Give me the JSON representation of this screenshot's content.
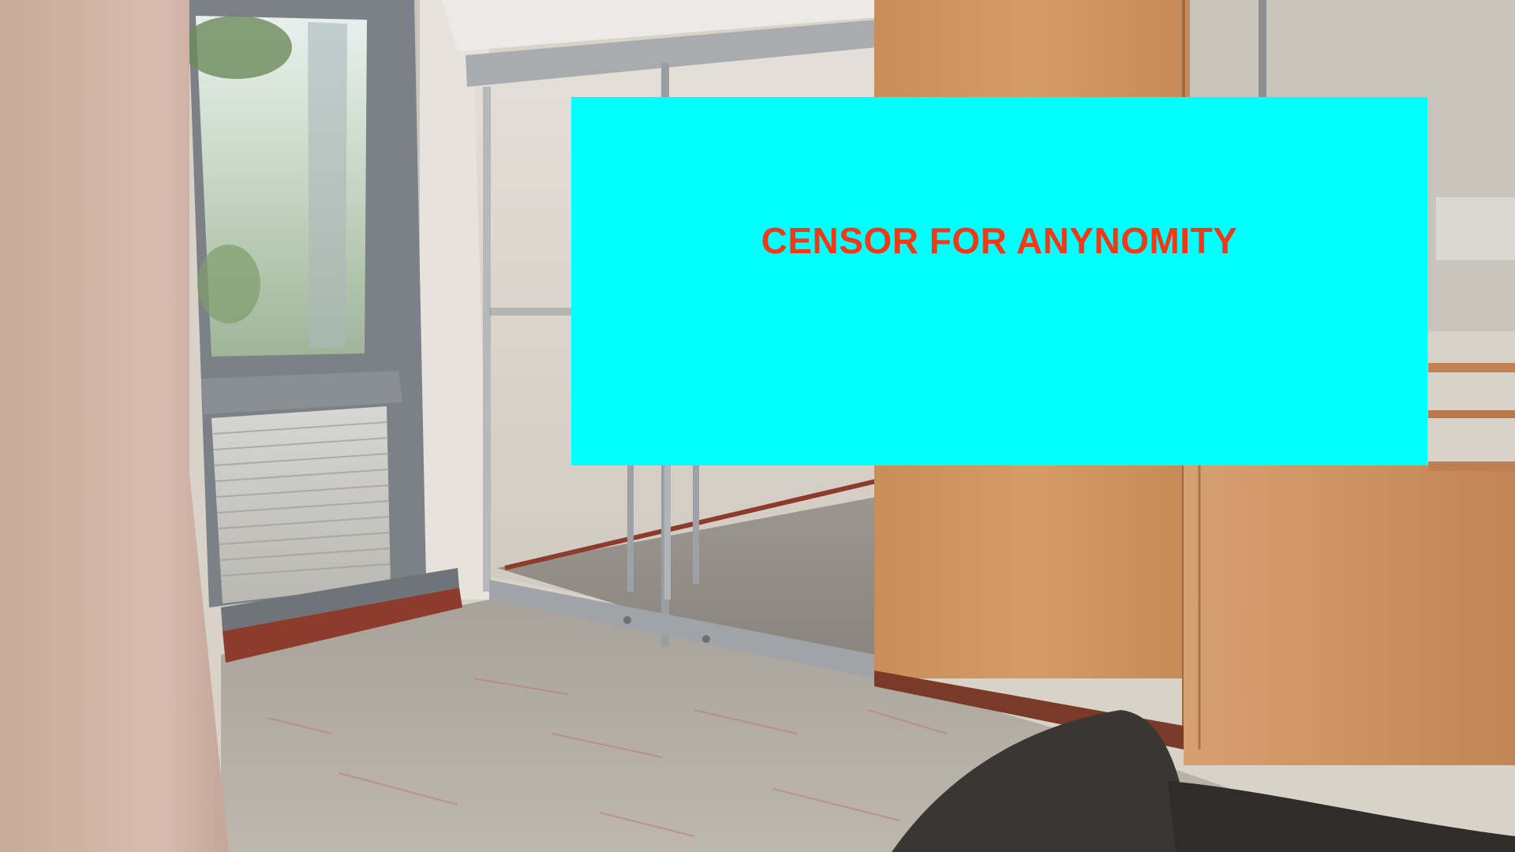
{
  "overlay": {
    "text": "CENSOR FOR ANYNOMITY",
    "background_color": "#00ffff",
    "text_color": "#f03a17"
  },
  "scene": {
    "subject": "office interior with glass entrance doors, window, carpet, wooden cabinets and a dark chair"
  }
}
